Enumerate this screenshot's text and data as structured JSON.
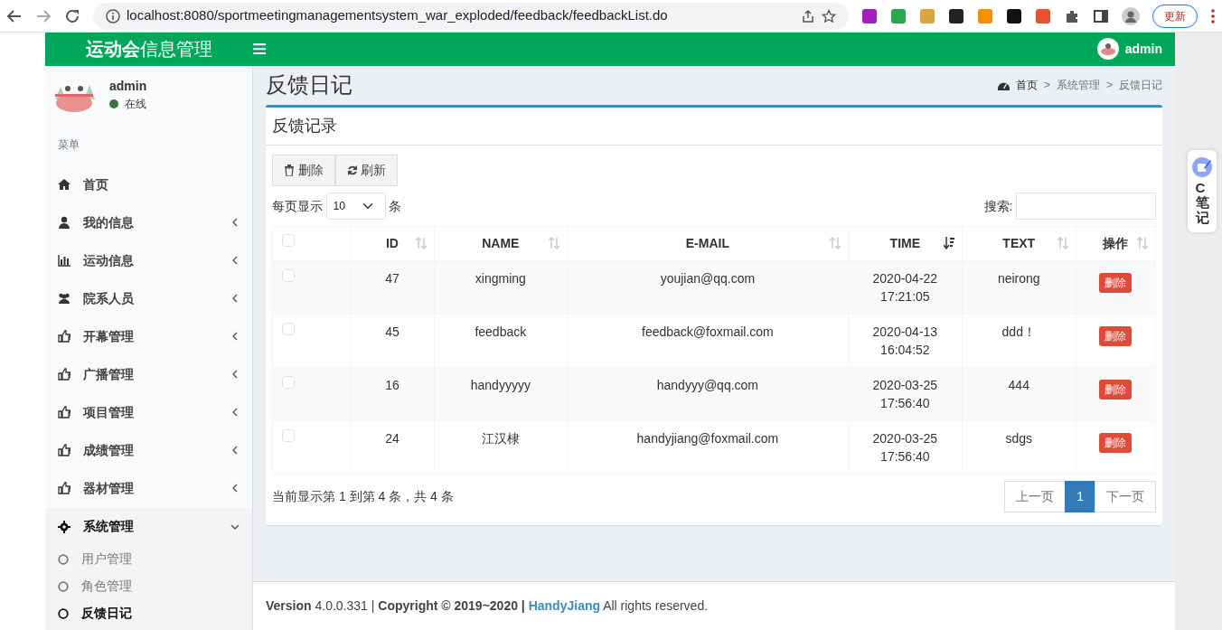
{
  "browser": {
    "url": "localhost:8080/sportmeetingmanagementsystem_war_exploded/feedback/feedbackList.do",
    "update_button": "更新"
  },
  "header": {
    "logo_bold": "运动会",
    "logo_rest": "信息管理",
    "user": "admin"
  },
  "sidebar": {
    "user": "admin",
    "status": "在线",
    "menu_header": "菜单",
    "items": [
      {
        "label": "首页",
        "kind": "link",
        "expanded": false
      },
      {
        "label": "我的信息",
        "kind": "tree",
        "expanded": false
      },
      {
        "label": "运动信息",
        "kind": "tree",
        "expanded": false
      },
      {
        "label": "院系人员",
        "kind": "tree",
        "expanded": false
      },
      {
        "label": "开幕管理",
        "kind": "tree",
        "expanded": false
      },
      {
        "label": "广播管理",
        "kind": "tree",
        "expanded": false
      },
      {
        "label": "项目管理",
        "kind": "tree",
        "expanded": false
      },
      {
        "label": "成绩管理",
        "kind": "tree",
        "expanded": false
      },
      {
        "label": "器材管理",
        "kind": "tree",
        "expanded": false
      },
      {
        "label": "系统管理",
        "kind": "tree",
        "expanded": true,
        "children": [
          {
            "label": "用户管理",
            "selected": false
          },
          {
            "label": "角色管理",
            "selected": false
          },
          {
            "label": "反馈日记",
            "selected": true
          }
        ]
      }
    ]
  },
  "content": {
    "title": "反馈日记",
    "breadcrumb": [
      {
        "label": "首页"
      },
      {
        "separator": ">",
        "label": "系统管理"
      },
      {
        "separator": ">",
        "label": "反馈日记"
      }
    ],
    "box_title": "反馈记录",
    "toolbar": [
      "删除",
      "刷新"
    ],
    "length_label": "每页显示",
    "page_size": "10",
    "length_unit": "条",
    "search_label": "搜索:",
    "table": {
      "select_all_checked": false,
      "columns": [
        {
          "label": "ID",
          "sorted": false
        },
        {
          "label": "NAME",
          "sorted": false
        },
        {
          "label": "E-MAIL",
          "sorted": false
        },
        {
          "label": "TIME",
          "sorted": true
        },
        {
          "label": "TEXT",
          "sorted": false
        },
        {
          "label": "操作",
          "sorted": false
        }
      ],
      "rows": [
        {
          "checked": false,
          "cells": [
            "47",
            "xingming",
            "youjian@qq.com",
            "2020-04-22 17:21:05",
            "neirong"
          ],
          "action": "删除"
        },
        {
          "checked": false,
          "cells": [
            "45",
            "feedback",
            "feedback@foxmail.com",
            "2020-04-13 16:04:52",
            "ddd！"
          ],
          "action": "删除"
        },
        {
          "checked": false,
          "cells": [
            "16",
            "handyyyyy",
            "handyyy@qq.com",
            "2020-03-25 17:56:40",
            "444"
          ],
          "action": "删除"
        },
        {
          "checked": false,
          "cells": [
            "24",
            "江汉棣",
            "handyjiang@foxmail.com",
            "2020-03-25 17:56:40",
            "sdgs"
          ],
          "action": "删除"
        }
      ]
    },
    "info": "当前显示第 1 到第 4 条，共 4 条",
    "pagination": [
      {
        "label": "上一页",
        "selected": false
      },
      {
        "label": "1",
        "selected": true
      },
      {
        "label": "下一页",
        "selected": false
      }
    ]
  },
  "footer": {
    "text": "**Version** 4.0.0.331 | **Copyright © 2019~2020 |**",
    "link": "HandyJiang",
    "rest": "All rights reserved."
  },
  "side_widget": {
    "label": "C笔记"
  }
}
